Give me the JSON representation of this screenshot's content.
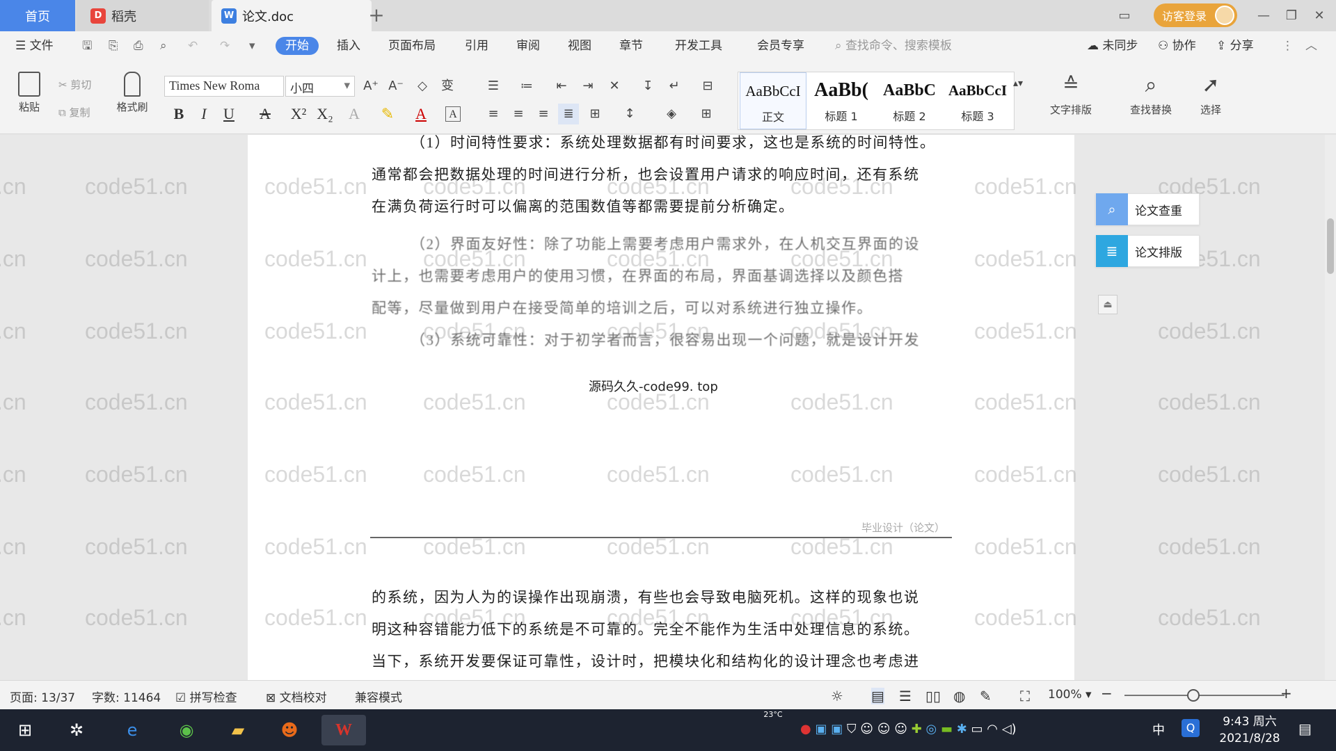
{
  "titlebar": {
    "tab_home": "首页",
    "tab_daoke": "稻壳",
    "tab_document": "论文.doc",
    "tab_add": "+",
    "visitor_login": "访客登录"
  },
  "menu": {
    "file": "文件",
    "items": [
      "开始",
      "插入",
      "页面布局",
      "引用",
      "审阅",
      "视图",
      "章节",
      "开发工具",
      "会员专享"
    ],
    "search_placeholder": "查找命令、搜索模板",
    "unsync": "未同步",
    "collaborate": "协作",
    "share": "分享"
  },
  "ribbon": {
    "paste": "粘贴",
    "cut": "剪切",
    "copy": "复制",
    "format_painter": "格式刷",
    "font_name": "Times New Roma",
    "font_size": "小四",
    "styles": [
      {
        "preview": "AaBbCcI",
        "label": "正文"
      },
      {
        "preview": "AaBb(",
        "label": "标题 1"
      },
      {
        "preview": "AaBbC",
        "label": "标题 2"
      },
      {
        "preview": "AaBbCcI",
        "label": "标题 3"
      }
    ],
    "text_layout": "文字排版",
    "find_replace": "查找替换",
    "select": "选择"
  },
  "document": {
    "para1_line1": "（1）时间特性要求：系统处理数据都有时间要求，这也是系统的时间特性。",
    "para1_line2": "通常都会把数据处理的时间进行分析，也会设置用户请求的响应时间，还有系统",
    "para1_line3": "在满负荷运行时可以偏离的范围数值等都需要提前分析确定。",
    "para2_line1": "（2）界面友好性：除了功能上需要考虑用户需求外，在人机交互界面的设",
    "para2_line2": "计上，也需要考虑用户的使用习惯，在界面的布局，界面基调选择以及颜色搭",
    "para2_line3": "配等，尽量做到用户在接受简单的培训之后，可以对系统进行独立操作。",
    "para3_line1": "（3）系统可靠性：对于初学者而言，很容易出现一个问题，就是设计开发",
    "caption": "源码久久-code99. top",
    "page_header": "毕业设计（论文）",
    "para4_line1": "的系统，因为人为的误操作出现崩溃，有些也会导致电脑死机。这样的现象也说",
    "para4_line2": "明这种容错能力低下的系统是不可靠的。完全不能作为生活中处理信息的系统。",
    "para4_line3": "当下，系统开发要保证可靠性，设计时，把模块化和结构化的设计理念也考虑进",
    "watermark": "code51.cn"
  },
  "side_panel": {
    "plagiarism_check": "论文查重",
    "paper_layout": "论文排版"
  },
  "statusbar": {
    "page": "页面: 13/37",
    "word_count": "字数: 11464",
    "spell_check": "拼写检查",
    "doc_proof": "文档校对",
    "compat_mode": "兼容模式",
    "zoom": "100%",
    "zoom_level": 100
  },
  "taskbar": {
    "temperature": "23°C",
    "ime": "中",
    "time": "9:43 周六",
    "date": "2021/8/28"
  },
  "colors": {
    "accent": "#4a86e8",
    "visitor": "#e9a43b",
    "taskbar": "#1d2330",
    "wps_red": "#d9342b"
  }
}
